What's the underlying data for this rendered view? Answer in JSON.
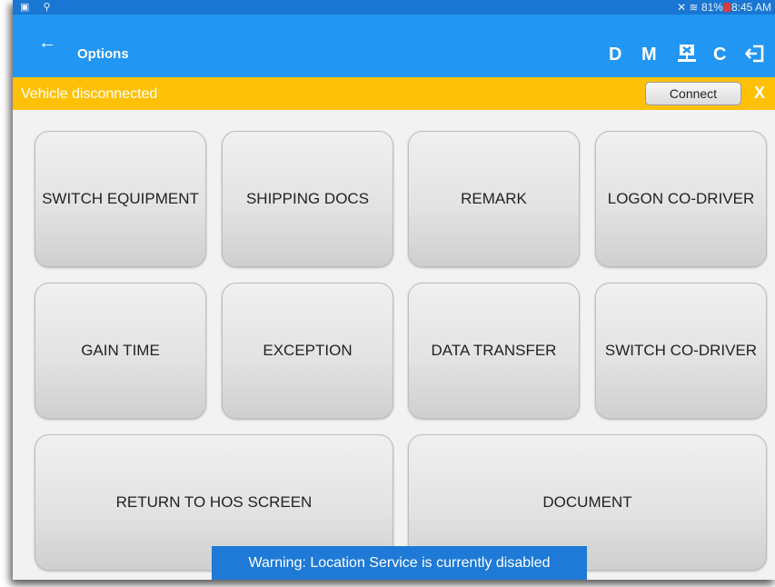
{
  "status_bar": {
    "left_icons": [
      "screenshot-icon",
      "usb-icon"
    ],
    "signal_icons": [
      "mute-icon",
      "wifi-icon"
    ],
    "battery": "81%",
    "time": "8:45 AM"
  },
  "app_bar": {
    "title": "Options",
    "back_icon": "←",
    "buttons": {
      "d_label": "D",
      "m_label": "M",
      "refresh_icon": "C",
      "elog_icon": "elog-disconnect-icon",
      "exit_icon": "exit-icon"
    }
  },
  "banner": {
    "message": "Vehicle disconnected",
    "connect_label": "Connect",
    "close_label": "X"
  },
  "options": [
    {
      "label": "SWITCH EQUIPMENT"
    },
    {
      "label": "SHIPPING DOCS"
    },
    {
      "label": "REMARK"
    },
    {
      "label": "LOGON CO-DRIVER"
    },
    {
      "label": "GAIN TIME"
    },
    {
      "label": "EXCEPTION"
    },
    {
      "label": "DATA TRANSFER"
    },
    {
      "label": "SWITCH CO-DRIVER"
    },
    {
      "label": "RETURN TO HOS SCREEN"
    },
    {
      "label": "DOCUMENT"
    }
  ],
  "toast": "Warning: Location Service is currently disabled",
  "colors": {
    "status_bar": "#1976d2",
    "app_bar": "#2196f3",
    "banner": "#ffc107",
    "toast": "#1e7ad6"
  }
}
